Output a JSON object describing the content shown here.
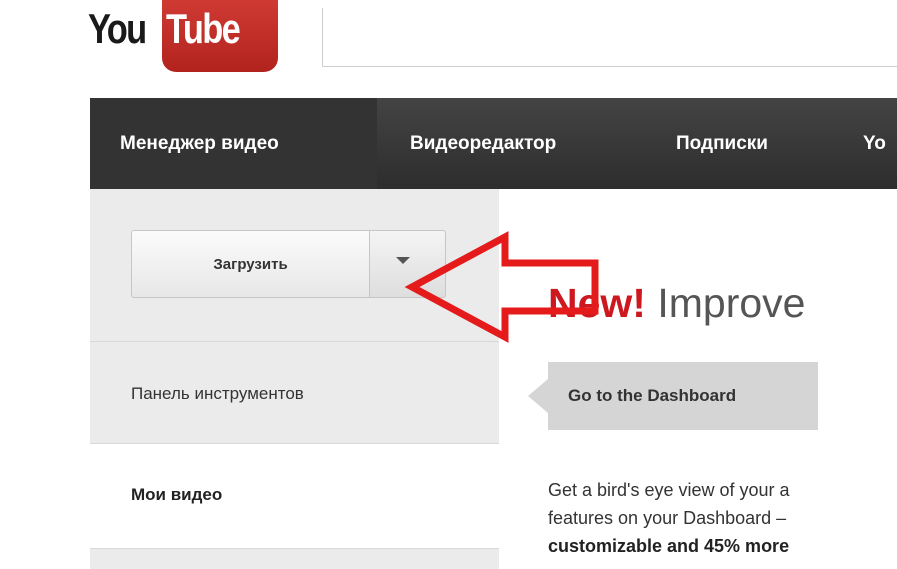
{
  "logo": {
    "you": "You",
    "tube": "Tube"
  },
  "nav": {
    "items": [
      {
        "label": "Менеджер видео"
      },
      {
        "label": "Видеоредактор"
      },
      {
        "label": "Подписки"
      },
      {
        "label": "Yo"
      }
    ]
  },
  "sidebar": {
    "upload_label": "Загрузить",
    "items": [
      {
        "label": "Панель инструментов"
      },
      {
        "label": "Мои видео"
      }
    ]
  },
  "main": {
    "headline_new": "New!",
    "headline_rest": " Improve",
    "dashboard_button": "Go to the Dashboard",
    "body_lines": [
      "Get a bird's eye view of your a",
      "features on your Dashboard –",
      "customizable and 45% more"
    ]
  },
  "colors": {
    "brand_red": "#cc181e",
    "annotation_red": "#e51b1b",
    "nav_bg": "#333333"
  },
  "icons": [
    "dropdown-caret-icon",
    "annotation-arrow-icon"
  ]
}
